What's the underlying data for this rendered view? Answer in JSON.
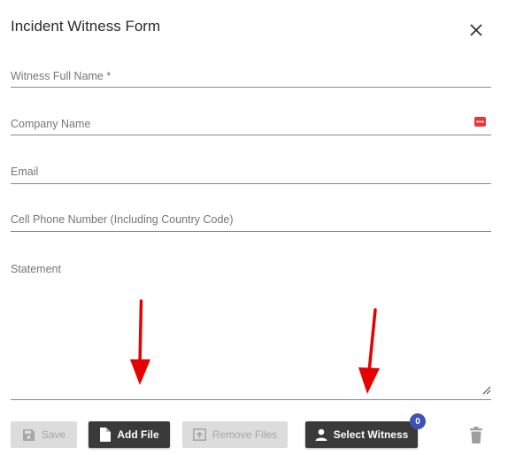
{
  "dialog": {
    "title": "Incident Witness Form",
    "close_icon": "close-icon"
  },
  "fields": {
    "witness_name": {
      "label": "Witness Full Name *",
      "value": ""
    },
    "company_name": {
      "label": "Company Name",
      "value": "",
      "icon": "contact-card-icon"
    },
    "email": {
      "label": "Email",
      "value": ""
    },
    "cell_phone": {
      "label": "Cell Phone Number (Including Country Code)",
      "value": ""
    },
    "statement": {
      "label": "Statement",
      "value": ""
    }
  },
  "actions": {
    "save": {
      "label": "Save",
      "icon": "save-icon",
      "enabled": false
    },
    "add_file": {
      "label": "Add File",
      "icon": "file-icon",
      "enabled": true
    },
    "remove_files": {
      "label": "Remove Files",
      "icon": "upload-box-icon",
      "enabled": false
    },
    "select_witness": {
      "label": "Select Witness",
      "icon": "person-icon",
      "enabled": true,
      "badge_count": "0"
    },
    "delete": {
      "icon": "trash-icon"
    }
  },
  "colors": {
    "dark_button": "#3a3a3a",
    "disabled_button": "#dcdcdc",
    "badge": "#3f51b5",
    "annotation_arrow": "#e60000",
    "card_icon": "#e53935"
  }
}
